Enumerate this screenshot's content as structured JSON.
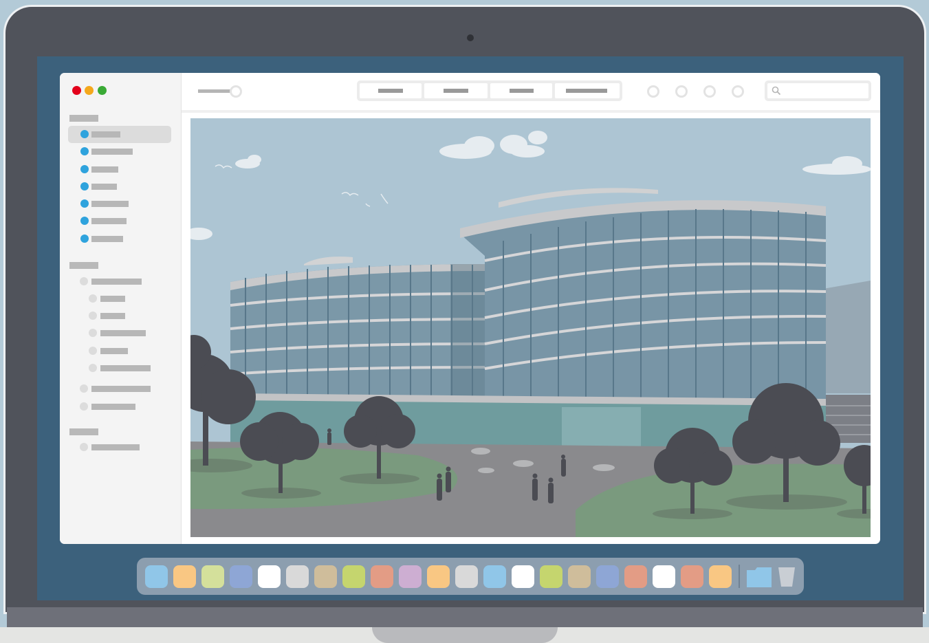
{
  "device": {
    "name": "laptop",
    "bezel_color": "#50535b",
    "screen_color": "#3c617c"
  },
  "window": {
    "traffic_lights": [
      {
        "name": "close",
        "color": "#e3001b"
      },
      {
        "name": "minimize",
        "color": "#f4a81c"
      },
      {
        "name": "zoom",
        "color": "#3aaa35"
      }
    ],
    "sidebar": {
      "sections": [
        {
          "heading_placeholder": true,
          "items": [
            {
              "icon": "blue-dot",
              "selected": true
            },
            {
              "icon": "blue-dot",
              "selected": false
            },
            {
              "icon": "blue-dot",
              "selected": false
            },
            {
              "icon": "blue-dot",
              "selected": false
            },
            {
              "icon": "blue-dot",
              "selected": false
            },
            {
              "icon": "blue-dot",
              "selected": false
            },
            {
              "icon": "blue-dot",
              "selected": false
            }
          ]
        },
        {
          "heading_placeholder": true,
          "items": [
            {
              "icon": "gray-dot",
              "nested": false
            },
            {
              "icon": "gray-dot",
              "nested": true
            },
            {
              "icon": "gray-dot",
              "nested": true
            },
            {
              "icon": "gray-dot",
              "nested": true
            },
            {
              "icon": "gray-dot",
              "nested": true
            },
            {
              "icon": "gray-dot",
              "nested": true
            },
            {
              "icon": "gray-dot",
              "nested": false
            },
            {
              "icon": "gray-dot",
              "nested": false
            }
          ]
        },
        {
          "heading_placeholder": true,
          "items": [
            {
              "icon": "gray-dot",
              "nested": false
            }
          ]
        }
      ],
      "accent_color": "#2fa3dd"
    },
    "toolbar": {
      "zoom_slider": true,
      "view_segments": 4,
      "round_buttons": 4,
      "search": {
        "icon": "search-icon",
        "placeholder": ""
      }
    },
    "content": {
      "type": "illustration",
      "subject": "modern-office-building",
      "sky_color": "#adc5d3",
      "ground_color": "#8a8a8d",
      "lawn_color": "#7a9a7e",
      "tree_color": "#4b4c53"
    }
  },
  "dock": {
    "icons": [
      {
        "color": "#90c6e8"
      },
      {
        "color": "#f9c783"
      },
      {
        "color": "#d4e09b"
      },
      {
        "color": "#8ea6d5"
      },
      {
        "color": "#ffffff"
      },
      {
        "color": "#d9d9d9"
      },
      {
        "color": "#cfbd9b"
      },
      {
        "color": "#c5d56e"
      },
      {
        "color": "#e39c85"
      },
      {
        "color": "#cdaed2"
      },
      {
        "color": "#f9c783"
      },
      {
        "color": "#d9d9d9"
      },
      {
        "color": "#90c6e8"
      },
      {
        "color": "#ffffff"
      },
      {
        "color": "#c5d56e"
      },
      {
        "color": "#cfbd9b"
      },
      {
        "color": "#8ea6d5"
      },
      {
        "color": "#e39c85"
      },
      {
        "color": "#ffffff"
      },
      {
        "color": "#e39c85"
      },
      {
        "color": "#f9c783"
      }
    ],
    "trailing": [
      {
        "icon": "folder-icon",
        "color": "#90c6e8"
      },
      {
        "icon": "trash-icon",
        "color": "#c9ced4"
      }
    ]
  }
}
